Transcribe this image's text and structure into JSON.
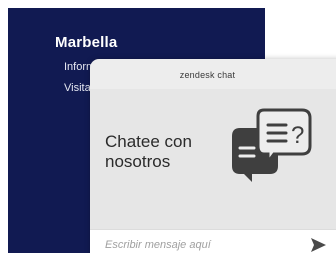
{
  "site": {
    "title": "Marbella",
    "nav_items": [
      "Información",
      "Visita"
    ]
  },
  "chat": {
    "brand": "zendesk chat",
    "cta": "Chatee con nosotros",
    "input_placeholder": "Escribir mensaje aquí",
    "send_icon": "send-arrow-icon",
    "illustration_icon": "chat-bubbles-icon"
  },
  "colors": {
    "navy_panel": "#111a52",
    "widget_bg": "#ededed",
    "icon_dark": "#3f3f3f"
  }
}
